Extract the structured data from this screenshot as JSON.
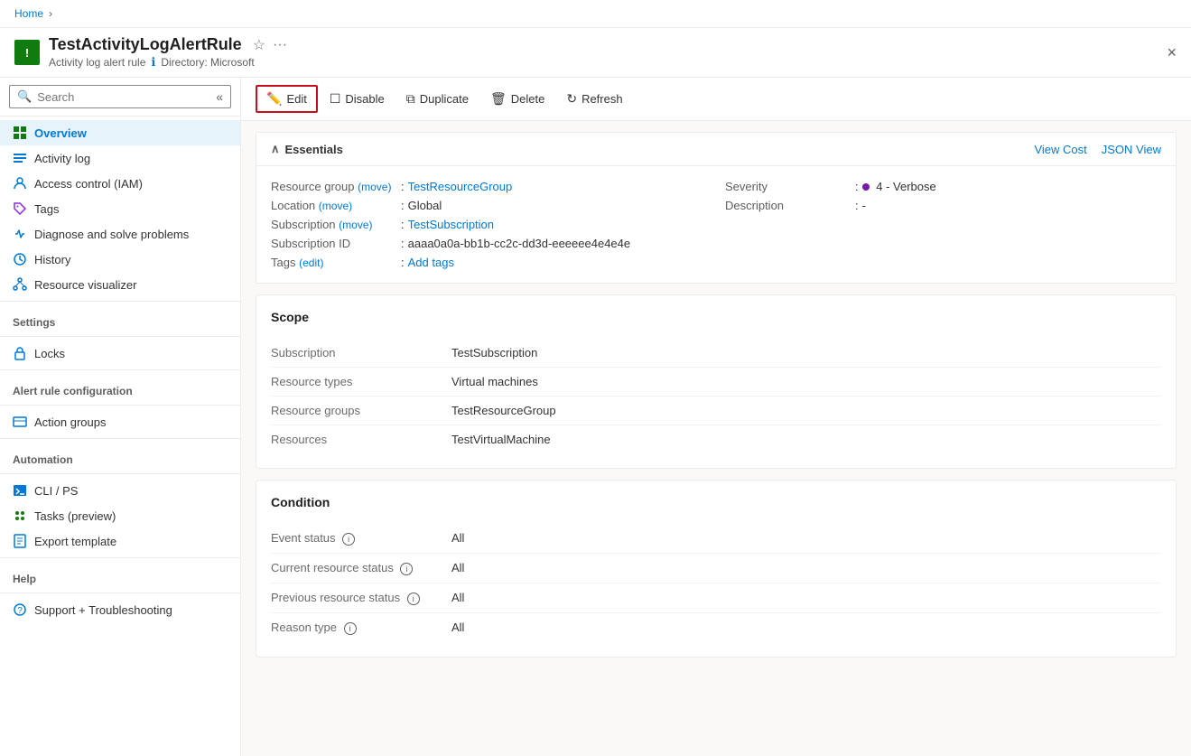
{
  "breadcrumb": {
    "home_label": "Home",
    "sep": "›"
  },
  "header": {
    "icon_text": "!",
    "title": "TestActivityLogAlertRule",
    "subtitle_type": "Activity log alert rule",
    "subtitle_info_icon": "ℹ",
    "directory_label": "Directory: Microsoft",
    "close_label": "×"
  },
  "toolbar": {
    "edit_label": "Edit",
    "disable_label": "Disable",
    "duplicate_label": "Duplicate",
    "delete_label": "Delete",
    "refresh_label": "Refresh"
  },
  "sidebar": {
    "search_placeholder": "Search",
    "nav_items": [
      {
        "id": "overview",
        "label": "Overview",
        "active": true
      },
      {
        "id": "activity-log",
        "label": "Activity log",
        "active": false
      },
      {
        "id": "access-control",
        "label": "Access control (IAM)",
        "active": false
      },
      {
        "id": "tags",
        "label": "Tags",
        "active": false
      },
      {
        "id": "diagnose",
        "label": "Diagnose and solve problems",
        "active": false
      },
      {
        "id": "history",
        "label": "History",
        "active": false
      },
      {
        "id": "resource-visualizer",
        "label": "Resource visualizer",
        "active": false
      }
    ],
    "settings_label": "Settings",
    "settings_items": [
      {
        "id": "locks",
        "label": "Locks",
        "active": false
      }
    ],
    "alert_rule_label": "Alert rule configuration",
    "alert_rule_items": [
      {
        "id": "action-groups",
        "label": "Action groups",
        "active": false
      }
    ],
    "automation_label": "Automation",
    "automation_items": [
      {
        "id": "cli-ps",
        "label": "CLI / PS",
        "active": false
      },
      {
        "id": "tasks",
        "label": "Tasks (preview)",
        "active": false
      },
      {
        "id": "export-template",
        "label": "Export template",
        "active": false
      }
    ],
    "help_label": "Help",
    "help_items": [
      {
        "id": "support",
        "label": "Support + Troubleshooting",
        "active": false
      }
    ]
  },
  "essentials": {
    "section_title": "Essentials",
    "view_cost_label": "View Cost",
    "json_view_label": "JSON View",
    "fields": {
      "resource_group_label": "Resource group",
      "resource_group_move": "(move)",
      "resource_group_value": "TestResourceGroup",
      "location_label": "Location",
      "location_move": "(move)",
      "location_value": "Global",
      "subscription_label": "Subscription",
      "subscription_move": "(move)",
      "subscription_value": "TestSubscription",
      "subscription_id_label": "Subscription ID",
      "subscription_id_value": "aaaa0a0a-bb1b-cc2c-dd3d-eeeeee4e4e4e",
      "tags_label": "Tags",
      "tags_edit": "(edit)",
      "tags_value": "Add tags",
      "severity_label": "Severity",
      "severity_value": "4 - Verbose",
      "description_label": "Description",
      "description_value": "-"
    }
  },
  "scope_card": {
    "title": "Scope",
    "rows": [
      {
        "label": "Subscription",
        "value": "TestSubscription"
      },
      {
        "label": "Resource types",
        "value": "Virtual machines"
      },
      {
        "label": "Resource groups",
        "value": "TestResourceGroup"
      },
      {
        "label": "Resources",
        "value": "TestVirtualMachine"
      }
    ]
  },
  "condition_card": {
    "title": "Condition",
    "rows": [
      {
        "label": "Event status",
        "value": "All",
        "has_info": true
      },
      {
        "label": "Current resource status",
        "value": "All",
        "has_info": true
      },
      {
        "label": "Previous resource status",
        "value": "All",
        "has_info": true
      },
      {
        "label": "Reason type",
        "value": "All",
        "has_info": true
      }
    ]
  }
}
